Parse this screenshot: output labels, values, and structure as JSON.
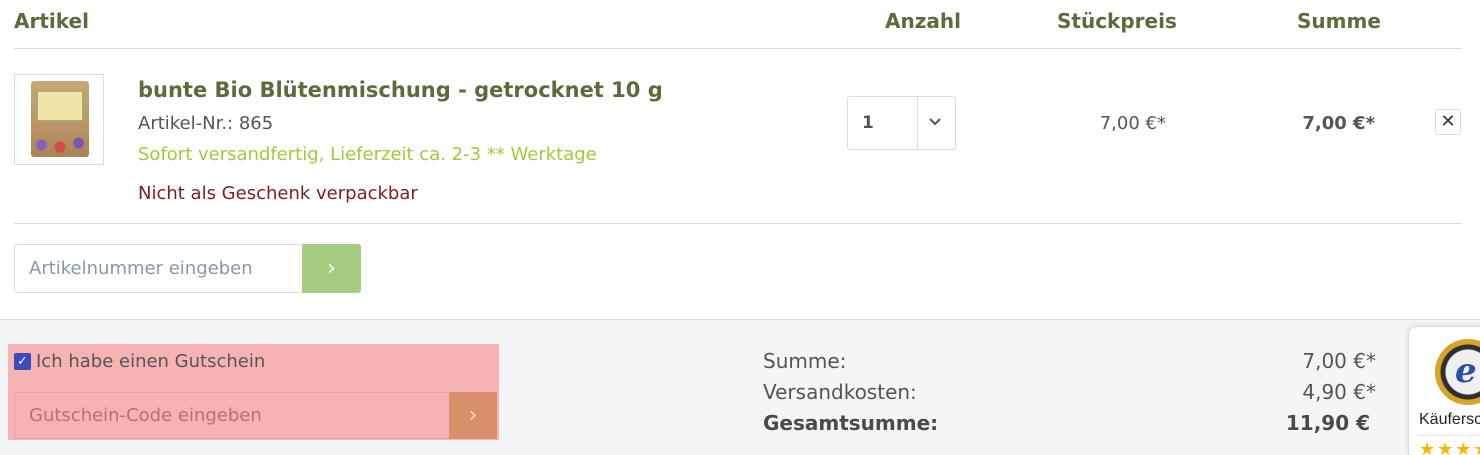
{
  "table_header": {
    "artikel": "Artikel",
    "anzahl": "Anzahl",
    "stueckpreis": "Stückpreis",
    "summe": "Summe"
  },
  "cart_item": {
    "title": "bunte Bio Blütenmischung - getrocknet 10 g",
    "article_number": "Artikel-Nr.: 865",
    "shipping": "Sofort versandfertig, Lieferzeit ca. 2-3 ** Werktage",
    "gift_note": "Nicht als Geschenk verpackbar",
    "quantity": "1",
    "unit_price": "7,00 €*",
    "line_total": "7,00 €*",
    "remove_symbol": "✕"
  },
  "add_article": {
    "placeholder": "Artikelnummer eingeben",
    "button_symbol": "›"
  },
  "voucher": {
    "checked": true,
    "checkbox_label": "Ich habe einen Gutschein",
    "placeholder": "Gutschein-Code eingeben",
    "button_symbol": "›"
  },
  "totals": {
    "subtotal_label": "Summe:",
    "subtotal_value": "7,00 €*",
    "shipping_label": "Versandkosten:",
    "shipping_value": "4,90 €*",
    "total_label": "Gesamtsumme:",
    "total_value": "11,90 €"
  },
  "trust_badge": {
    "logo_letter": "e",
    "text": "Käuferschutz",
    "stars": "★★★★★"
  },
  "colors": {
    "brand_green": "#5b6b3c",
    "shipping_green": "#a0c93b",
    "gift_red": "#7a1f1f",
    "voucher_highlight": "#f7b2b4",
    "button_green": "#a6cc82"
  }
}
